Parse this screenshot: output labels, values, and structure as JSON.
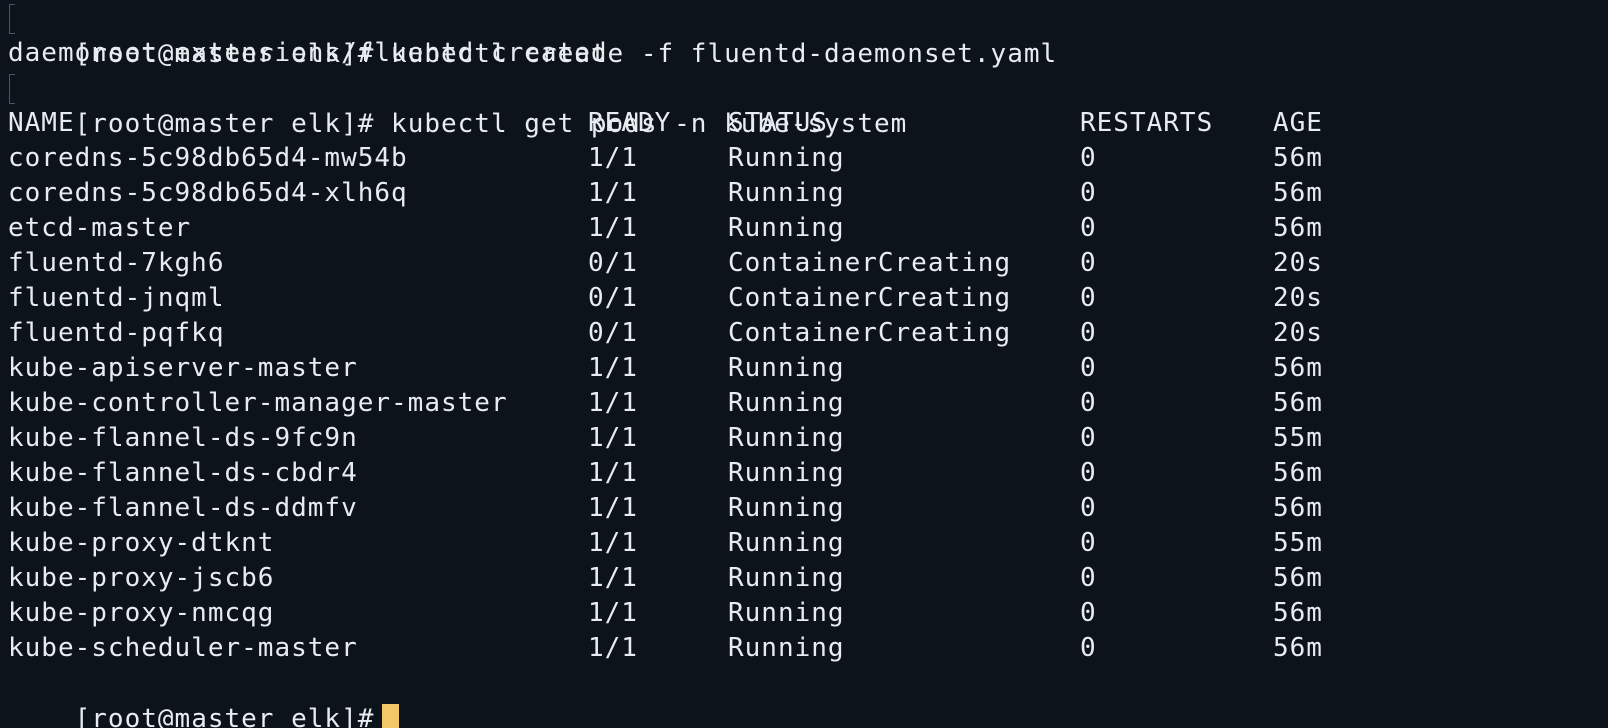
{
  "terminal": {
    "cmd1": "[root@master elk]# kubectl create -f fluentd-daemonset.yaml",
    "output1": "daemonset.extensions/fluentd created",
    "cmd2": "[root@master elk]# kubectl get pods -n kube-system",
    "headers": {
      "name": "NAME",
      "ready": "READY",
      "status": "STATUS",
      "restarts": "RESTARTS",
      "age": "AGE"
    },
    "rows": [
      {
        "name": "coredns-5c98db65d4-mw54b",
        "ready": "1/1",
        "status": "Running",
        "restarts": "0",
        "age": "56m"
      },
      {
        "name": "coredns-5c98db65d4-xlh6q",
        "ready": "1/1",
        "status": "Running",
        "restarts": "0",
        "age": "56m"
      },
      {
        "name": "etcd-master",
        "ready": "1/1",
        "status": "Running",
        "restarts": "0",
        "age": "56m"
      },
      {
        "name": "fluentd-7kgh6",
        "ready": "0/1",
        "status": "ContainerCreating",
        "restarts": "0",
        "age": "20s"
      },
      {
        "name": "fluentd-jnqml",
        "ready": "0/1",
        "status": "ContainerCreating",
        "restarts": "0",
        "age": "20s"
      },
      {
        "name": "fluentd-pqfkq",
        "ready": "0/1",
        "status": "ContainerCreating",
        "restarts": "0",
        "age": "20s"
      },
      {
        "name": "kube-apiserver-master",
        "ready": "1/1",
        "status": "Running",
        "restarts": "0",
        "age": "56m"
      },
      {
        "name": "kube-controller-manager-master",
        "ready": "1/1",
        "status": "Running",
        "restarts": "0",
        "age": "56m"
      },
      {
        "name": "kube-flannel-ds-9fc9n",
        "ready": "1/1",
        "status": "Running",
        "restarts": "0",
        "age": "55m"
      },
      {
        "name": "kube-flannel-ds-cbdr4",
        "ready": "1/1",
        "status": "Running",
        "restarts": "0",
        "age": "56m"
      },
      {
        "name": "kube-flannel-ds-ddmfv",
        "ready": "1/1",
        "status": "Running",
        "restarts": "0",
        "age": "56m"
      },
      {
        "name": "kube-proxy-dtknt",
        "ready": "1/1",
        "status": "Running",
        "restarts": "0",
        "age": "55m"
      },
      {
        "name": "kube-proxy-jscb6",
        "ready": "1/1",
        "status": "Running",
        "restarts": "0",
        "age": "56m"
      },
      {
        "name": "kube-proxy-nmcqg",
        "ready": "1/1",
        "status": "Running",
        "restarts": "0",
        "age": "56m"
      },
      {
        "name": "kube-scheduler-master",
        "ready": "1/1",
        "status": "Running",
        "restarts": "0",
        "age": "56m"
      }
    ],
    "prompt": "[root@master elk]#"
  },
  "colors": {
    "background": "#0d131b",
    "text": "#e8ecf0",
    "cursor": "#f3c766"
  }
}
